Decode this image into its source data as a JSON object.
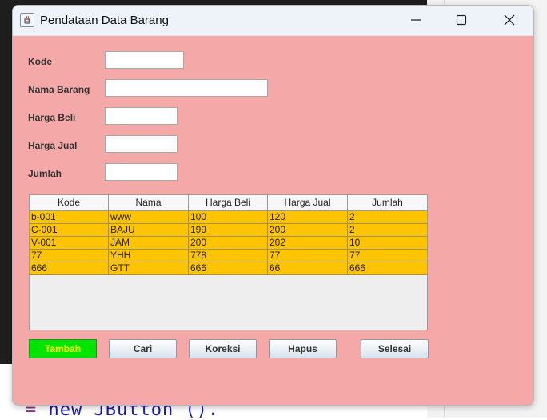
{
  "window": {
    "title": "Pendataan Data Barang"
  },
  "form": {
    "kode": {
      "label": "Kode",
      "value": ""
    },
    "nama": {
      "label": "Nama Barang",
      "value": ""
    },
    "beli": {
      "label": "Harga Beli",
      "value": ""
    },
    "jual": {
      "label": "Harga Jual",
      "value": ""
    },
    "jumlah": {
      "label": "Jumlah",
      "value": ""
    }
  },
  "table": {
    "columns": [
      "Kode",
      "Nama",
      "Harga Beli",
      "Harga Jual",
      "Jumlah"
    ],
    "rows": [
      [
        "b-001",
        "www",
        "100",
        "120",
        "2"
      ],
      [
        "C-001",
        "BAJU",
        "199",
        "200",
        "2"
      ],
      [
        "V-001",
        "JAM",
        "200",
        "202",
        "10"
      ],
      [
        "77",
        "YHH",
        "778",
        "77",
        "77"
      ],
      [
        "666",
        "GTT",
        "666",
        "66",
        "666"
      ]
    ],
    "row_color": "#ffc400"
  },
  "buttons": {
    "tambah": "Tambah",
    "cari": "Cari",
    "koreksi": "Koreksi",
    "hapus": "Hapus",
    "selesai": "Selesai"
  },
  "background_code": {
    "eq": "=",
    "text": "new JButton ()."
  },
  "colors": {
    "window_bg": "#f4a9a8",
    "tambah_bg": "#00e400",
    "tambah_text": "#ffff00"
  },
  "icons": {
    "app": "java-app-icon",
    "minimize": "minimize-icon",
    "maximize": "maximize-icon",
    "close": "close-icon"
  }
}
